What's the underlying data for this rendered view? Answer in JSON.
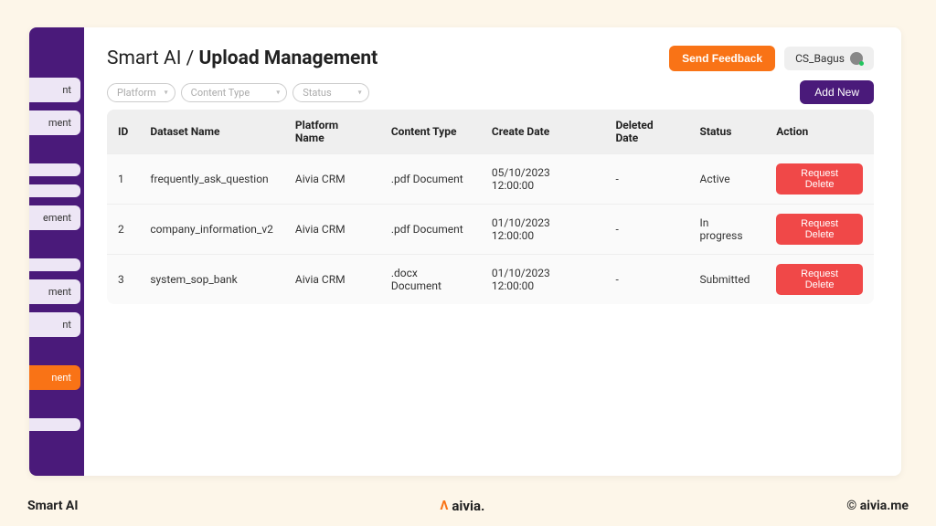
{
  "breadcrumb": {
    "parent": "Smart AI",
    "sep": "/",
    "current": "Upload Management"
  },
  "header": {
    "feedback": "Send Feedback",
    "username": "CS_Bagus",
    "addNew": "Add New"
  },
  "filters": {
    "platform": "Platform",
    "contentType": "Content Type",
    "status": "Status"
  },
  "sidebar": {
    "items": [
      {
        "label": "nt"
      },
      {
        "label": "ment"
      },
      {
        "label": " "
      },
      {
        "label": " "
      },
      {
        "label": "ement"
      },
      {
        "label": " "
      },
      {
        "label": "ment"
      },
      {
        "label": "nt"
      },
      {
        "label": "nent",
        "active": true
      },
      {
        "label": " "
      }
    ]
  },
  "table": {
    "columns": {
      "id": "ID",
      "dataset": "Dataset Name",
      "platform": "Platform Name",
      "contentType": "Content Type",
      "createDate": "Create Date",
      "deletedDate": "Deleted Date",
      "status": "Status",
      "action": "Action"
    },
    "actionLabel": "Request Delete",
    "rows": [
      {
        "id": "1",
        "dataset": "frequently_ask_question",
        "platform": "Aivia CRM",
        "contentType": ".pdf Document",
        "createDate": "05/10/2023 12:00:00",
        "deletedDate": "-",
        "status": "Active"
      },
      {
        "id": "2",
        "dataset": "company_information_v2",
        "platform": "Aivia CRM",
        "contentType": ".pdf Document",
        "createDate": "01/10/2023 12:00:00",
        "deletedDate": "-",
        "status": "In progress"
      },
      {
        "id": "3",
        "dataset": "system_sop_bank",
        "platform": "Aivia CRM",
        "contentType": ".docx Document",
        "createDate": "01/10/2023 12:00:00",
        "deletedDate": "-",
        "status": "Submitted"
      }
    ]
  },
  "footer": {
    "left": "Smart AI",
    "centerLogo": "aivia.",
    "right": "© aivia.me"
  }
}
